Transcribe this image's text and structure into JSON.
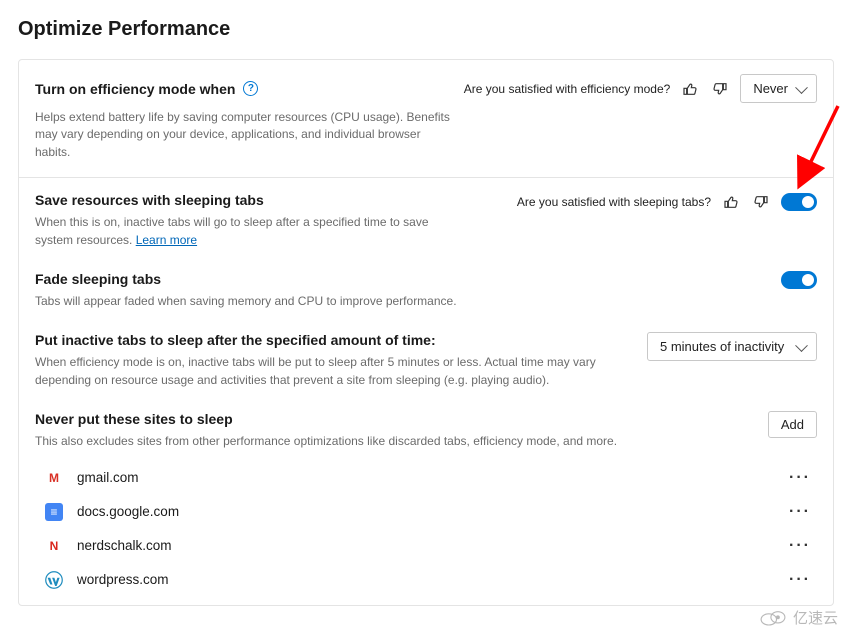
{
  "page": {
    "title": "Optimize Performance"
  },
  "efficiency": {
    "title": "Turn on efficiency mode when",
    "desc": "Helps extend battery life by saving computer resources (CPU usage). Benefits may vary depending on your device, applications, and individual browser habits.",
    "question": "Are you satisfied with efficiency mode?",
    "select_value": "Never"
  },
  "sleeping": {
    "title": "Save resources with sleeping tabs",
    "desc_prefix": "When this is on, inactive tabs will go to sleep after a specified time to save system resources.",
    "learn_more": "Learn more",
    "question": "Are you satisfied with sleeping tabs?",
    "toggle_on": true
  },
  "fade": {
    "title": "Fade sleeping tabs",
    "desc": "Tabs will appear faded when saving memory and CPU to improve performance.",
    "toggle_on": true
  },
  "inactive": {
    "title": "Put inactive tabs to sleep after the specified amount of time:",
    "desc": "When efficiency mode is on, inactive tabs will be put to sleep after 5 minutes or less. Actual time may vary depending on resource usage and activities that prevent a site from sleeping (e.g. playing audio).",
    "select_value": "5 minutes of inactivity"
  },
  "never_sleep": {
    "title": "Never put these sites to sleep",
    "desc": "This also excludes sites from other performance optimizations like discarded tabs, efficiency mode, and more.",
    "add_label": "Add",
    "sites": [
      {
        "domain": "gmail.com",
        "icon": "gmail"
      },
      {
        "domain": "docs.google.com",
        "icon": "docs"
      },
      {
        "domain": "nerdschalk.com",
        "icon": "nerdschalk"
      },
      {
        "domain": "wordpress.com",
        "icon": "wordpress"
      }
    ]
  },
  "watermark": "亿速云"
}
